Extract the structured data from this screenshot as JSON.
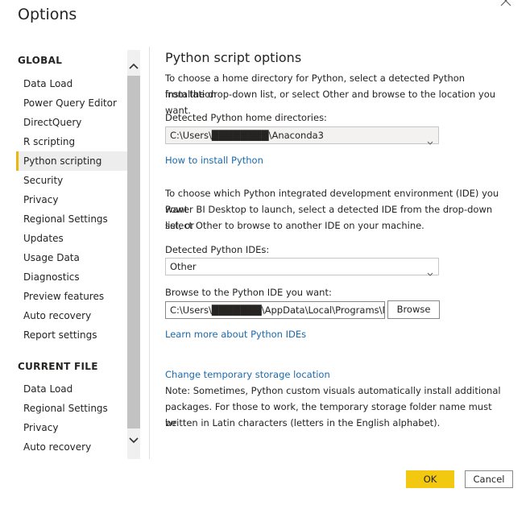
{
  "dialog": {
    "title": "Options"
  },
  "sidebar": {
    "global_heading": "GLOBAL",
    "global_items": [
      "Data Load",
      "Power Query Editor",
      "DirectQuery",
      "R scripting",
      "Python scripting",
      "Security",
      "Privacy",
      "Regional Settings",
      "Updates",
      "Usage Data",
      "Diagnostics",
      "Preview features",
      "Auto recovery",
      "Report settings"
    ],
    "selected_item": "Python scripting",
    "current_file_heading": "CURRENT FILE",
    "current_file_items": [
      "Data Load",
      "Regional Settings",
      "Privacy",
      "Auto recovery"
    ]
  },
  "main": {
    "title": "Python script options",
    "intro_line1": "To choose a home directory for Python, select a detected Python installation",
    "intro_line2": "from the drop-down list, or select Other and browse to the location you want.",
    "home_dirs_label": "Detected Python home directories:",
    "home_dir_value": "C:\\Users\\████████\\Anaconda3",
    "install_link": "How to install Python",
    "ide_line1": "To choose which Python integrated development environment (IDE) you want",
    "ide_line2": "Power BI Desktop to launch, select a detected IDE from the drop-down list, or",
    "ide_line3": "select Other to browse to another IDE on your machine.",
    "ides_label": "Detected Python IDEs:",
    "ide_value": "Other",
    "browse_label": "Browse to the Python IDE you want:",
    "ide_path_value": "C:\\Users\\███████\\AppData\\Local\\Programs\\M",
    "browse_button": "Browse",
    "ide_link": "Learn more about Python IDEs",
    "storage_link": "Change temporary storage location",
    "note_line1": "Note: Sometimes, Python custom visuals automatically install additional",
    "note_line2": "packages. For those to work, the temporary storage folder name must be",
    "note_line3": "written in Latin characters (letters in the English alphabet)."
  },
  "footer": {
    "ok_label": "OK",
    "cancel_label": "Cancel"
  },
  "colors": {
    "accent": "#f2c811",
    "link": "#1a6aad",
    "selected_bg": "#ededed"
  },
  "icons": {
    "close": "close-icon",
    "scroll_up": "chevron-up-icon",
    "scroll_down": "chevron-down-icon",
    "dropdown": "chevron-down-icon"
  }
}
